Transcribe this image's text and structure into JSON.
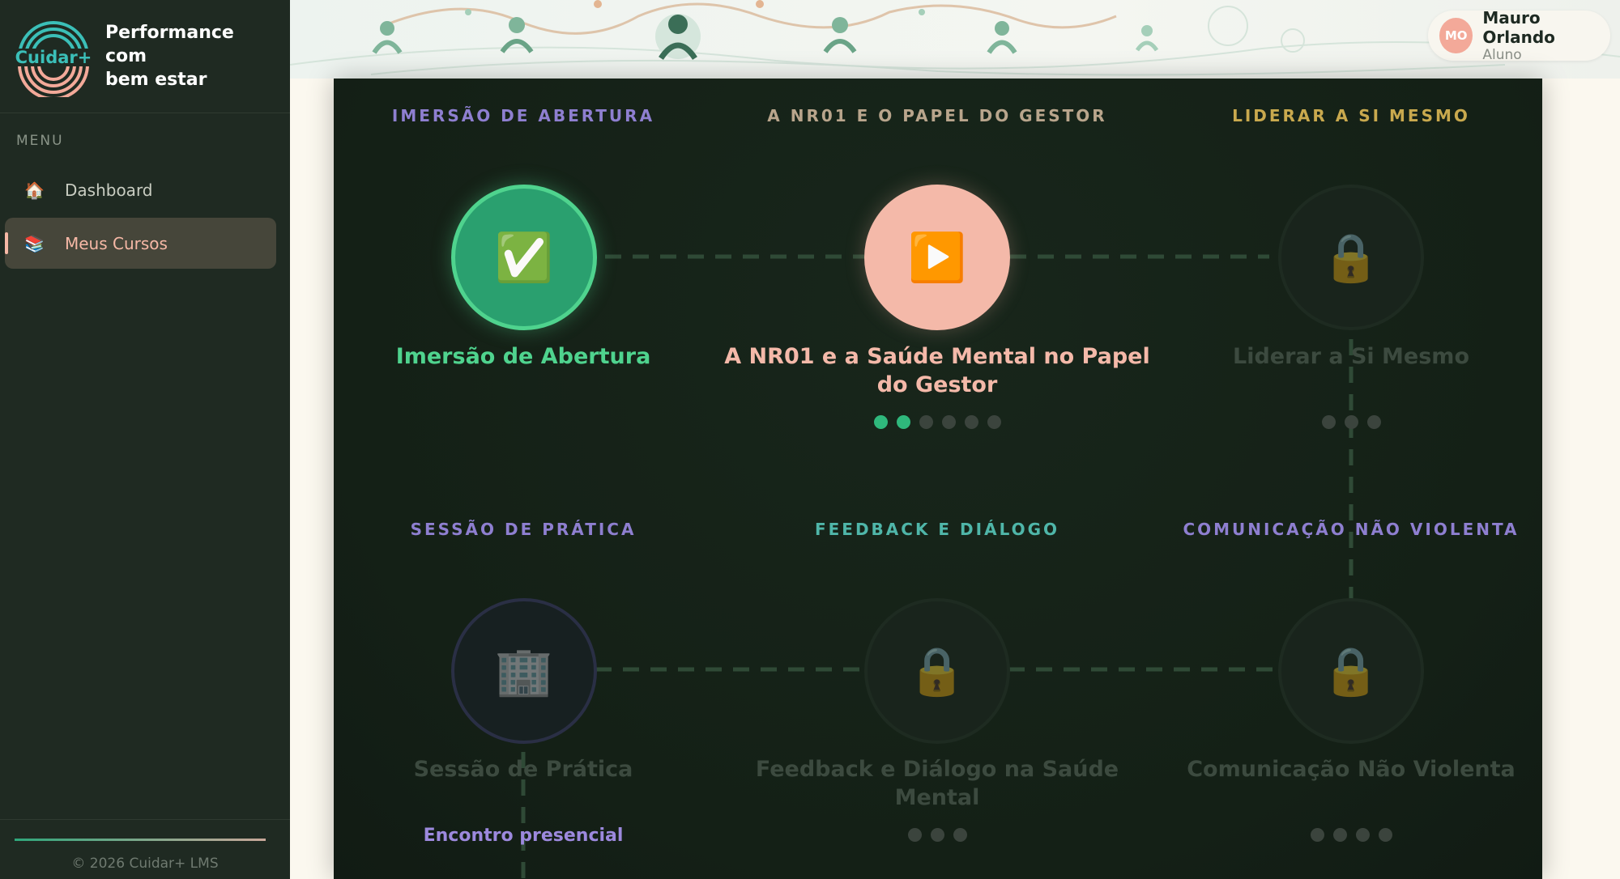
{
  "brand": {
    "name": "Cuidar+",
    "tagline": "Performance\ncom\nbem estar"
  },
  "sidebar": {
    "menu_label": "MENU",
    "items": [
      {
        "label": "Dashboard",
        "icon": "house-icon",
        "active": false
      },
      {
        "label": "Meus Cursos",
        "icon": "books-icon",
        "active": true
      }
    ],
    "footer": "© 2026 Cuidar+ LMS"
  },
  "user": {
    "initials": "MO",
    "name": "Mauro Orlando",
    "role": "Aluno"
  },
  "modules": [
    {
      "section": "IMERSÃO DE ABERTURA",
      "title": "Imersão de Abertura",
      "status": "completed",
      "icon": "check-icon",
      "progress": null
    },
    {
      "section": "A NR01 E O PAPEL DO GESTOR",
      "title": "A NR01 e a Saúde Mental no Papel do Gestor",
      "status": "in-progress",
      "icon": "play-icon",
      "progress": {
        "done": 2,
        "total": 6
      }
    },
    {
      "section": "LIDERAR A SI MESMO",
      "title": "Liderar a Si Mesmo",
      "status": "locked",
      "icon": "lock-icon",
      "progress": {
        "done": 0,
        "total": 3
      }
    },
    {
      "section": "SESSÃO DE PRÁTICA",
      "title": "Sessão de Prática",
      "status": "practice",
      "icon": "building-icon",
      "note": "Encontro presencial"
    },
    {
      "section": "FEEDBACK E DIÁLOGO",
      "title": "Feedback e Diálogo na Saúde Mental",
      "status": "locked",
      "icon": "lock-icon",
      "progress": {
        "done": 0,
        "total": 3
      }
    },
    {
      "section": "COMUNICAÇÃO NÃO VIOLENTA",
      "title": "Comunicação Não Violenta",
      "status": "locked",
      "icon": "lock-icon",
      "progress": {
        "done": 0,
        "total": 4
      }
    }
  ],
  "colors": {
    "sidebar_bg": "#1f2a22",
    "panel_bg": "#142016",
    "completed": "#4fd38e",
    "current": "#f4b9a9",
    "section_purple": "#8e7fd0",
    "section_tan": "#b9a58c",
    "section_gold": "#c9a94e",
    "section_teal": "#4fb6a9",
    "locked_text": "#3c4a3f"
  }
}
